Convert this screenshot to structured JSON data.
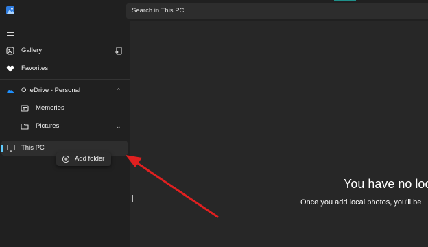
{
  "search": {
    "placeholder": "Search in This PC"
  },
  "sidebar": {
    "items": [
      {
        "label": "Gallery",
        "icon": "gallery-icon"
      },
      {
        "label": "Favorites",
        "icon": "heart-icon"
      },
      {
        "label": "OneDrive - Personal",
        "icon": "cloud-icon",
        "expanded": true
      },
      {
        "label": "Memories",
        "icon": "memories-icon"
      },
      {
        "label": "Pictures",
        "icon": "folder-icon",
        "collapsed": true
      },
      {
        "label": "This PC",
        "icon": "monitor-icon",
        "selected": true
      }
    ],
    "accent_color": "#60cdff",
    "onedrive_color": "#1e90ff"
  },
  "popup": {
    "label": "Add folder",
    "icon": "add-circle-icon"
  },
  "empty_state": {
    "title": "You have no loc",
    "subtitle": "Once you add local photos, you'll be"
  },
  "annotation": {
    "arrow_color": "#e02020"
  }
}
